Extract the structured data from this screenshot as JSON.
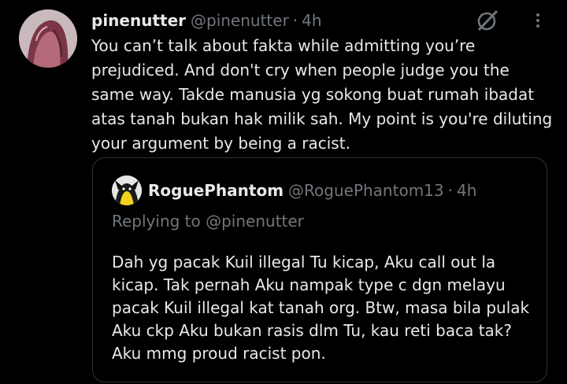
{
  "tweet": {
    "display_name": "pinenutter",
    "handle": "@pinenutter",
    "separator": "·",
    "time": "4h",
    "text": "You can’t talk about fakta while admitting you’re\nprejudiced. And don't cry when people judge you the\nsame way. Takde manusia yg sokong buat rumah ibadat\natas tanah bukan hak milik sah. My point is you're diluting\nyour argument by being a racist.",
    "icons": {
      "grok": "grok-icon",
      "more": "more-options-icon"
    }
  },
  "quoted_tweet": {
    "display_name": "RoguePhantom",
    "handle": "@RoguePhantom13",
    "separator": "·",
    "time": "4h",
    "replying_to": "Replying to @pinenutter",
    "text": "Dah yg pacak Kuil illegal Tu kicap, Aku call out la\nkicap. Tak pernah Aku nampak type c dgn melayu\npacak Kuil illegal kat tanah org. Btw, masa bila pulak\nAku ckp Aku bukan rasis dlm Tu, kau reti baca tak?\nAku mmg proud racist pon."
  },
  "colors": {
    "background": "#000000",
    "text": "#e7e9ea",
    "secondary": "#71767b",
    "border": "#2f3336"
  }
}
